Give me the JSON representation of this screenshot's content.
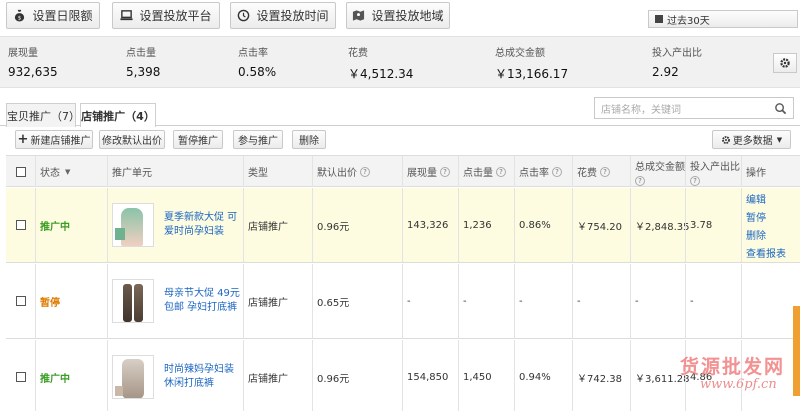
{
  "toolbar": {
    "daily_limit": "设置日限额",
    "platform": "设置投放平台",
    "time": "设置投放时间",
    "region": "设置投放地域",
    "range": "过去30天"
  },
  "metrics": [
    {
      "label": "展现量",
      "value": "932,635"
    },
    {
      "label": "点击量",
      "value": "5,398"
    },
    {
      "label": "点击率",
      "value": "0.58%"
    },
    {
      "label": "花费",
      "value": "￥4,512.34"
    },
    {
      "label": "总成交金额",
      "value": "￥13,166.17"
    },
    {
      "label": "投入产出比",
      "value": "2.92"
    }
  ],
  "tabs": [
    {
      "label": "宝贝推广（7）"
    },
    {
      "label": "店铺推广（4）"
    }
  ],
  "search": {
    "placeholder": "店铺名称，关键词"
  },
  "actions": {
    "new": "新建店铺推广",
    "edit_bid": "修改默认出价",
    "pause": "暂停推广",
    "join": "参与推广",
    "delete": "删除",
    "more": "更多数据"
  },
  "headers": {
    "status": "状态",
    "unit": "推广单元",
    "type": "类型",
    "bid": "默认出价",
    "impressions": "展现量",
    "clicks": "点击量",
    "ctr": "点击率",
    "cost": "花费",
    "gmv": "总成交金额",
    "roi": "投入产出比",
    "ops": "操作"
  },
  "rows": [
    {
      "status": "推广中",
      "title": "夏季新款大促 可爱时尚孕妇装",
      "type": "店铺推广",
      "bid": "0.96元",
      "impressions": "143,326",
      "clicks": "1,236",
      "ctr": "0.86%",
      "cost": "￥754.20",
      "gmv": "￥2,848.35",
      "roi": "3.78"
    },
    {
      "status": "暂停",
      "title": "母亲节大促 49元包邮 孕妇打底裤",
      "type": "店铺推广",
      "bid": "0.65元",
      "impressions": "-",
      "clicks": "-",
      "ctr": "-",
      "cost": "-",
      "gmv": "-",
      "roi": "-"
    },
    {
      "status": "推广中",
      "title": "时尚辣妈孕妇装 休闲打底裤",
      "type": "店铺推广",
      "bid": "0.96元",
      "impressions": "154,850",
      "clicks": "1,450",
      "ctr": "0.94%",
      "cost": "￥742.38",
      "gmv": "￥3,611.28",
      "roi": "4.86"
    }
  ],
  "row_ops": [
    "编辑",
    "暂停",
    "删除",
    "查看报表"
  ],
  "watermark": {
    "cn": "货源批发网",
    "url": "www.6pf.cn"
  }
}
